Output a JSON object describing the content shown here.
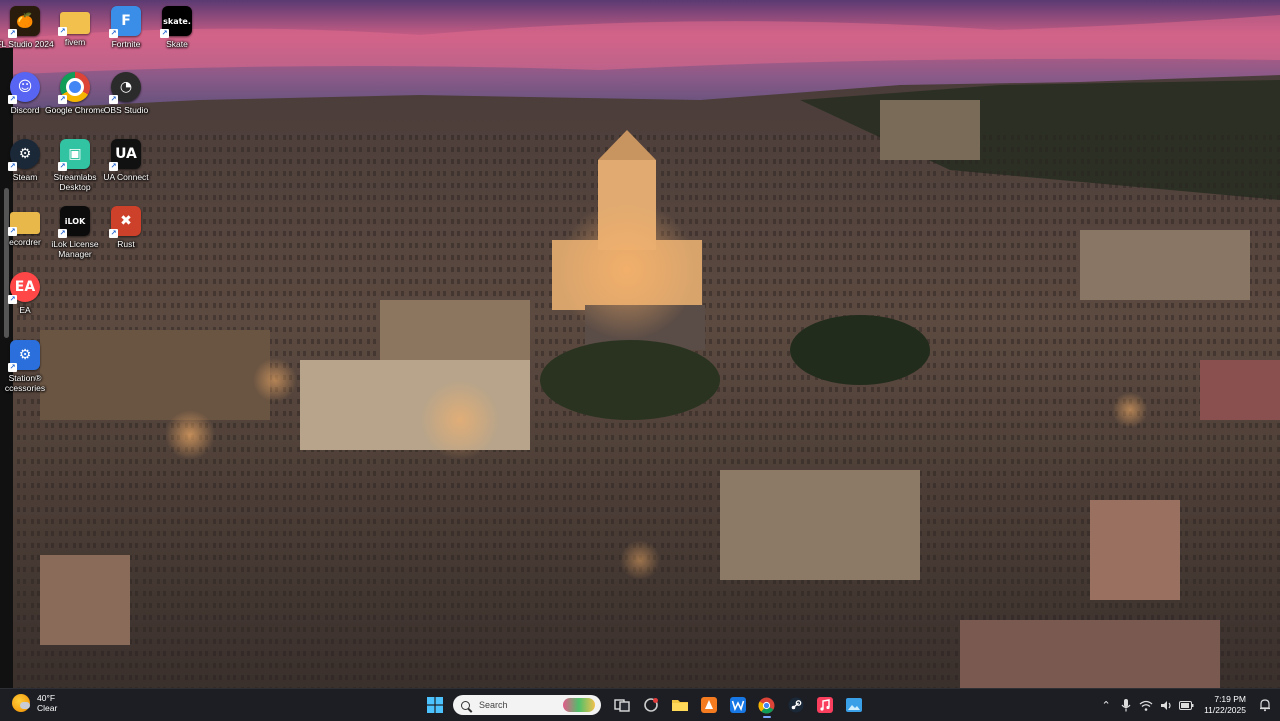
{
  "desktop": {
    "icons": [
      {
        "label": "FL Studio 2024",
        "icon": "fl-studio-icon",
        "bg": "#2a1c0c",
        "glyph": "🍊"
      },
      {
        "label": "fivem",
        "icon": "folder-icon",
        "bg": "#f2c14d",
        "glyph": ""
      },
      {
        "label": "Fortnite",
        "icon": "fortnite-icon",
        "bg": "#3a8ee8",
        "glyph": "F"
      },
      {
        "label": "Skate",
        "icon": "skate-icon",
        "bg": "#000000",
        "glyph": "skate."
      },
      {
        "label": "Discord",
        "icon": "discord-icon",
        "bg": "#5865f2",
        "glyph": "☺"
      },
      {
        "label": "Google Chrome",
        "icon": "chrome-icon",
        "bg": "#ffffff",
        "glyph": ""
      },
      {
        "label": "OBS Studio",
        "icon": "obs-icon",
        "bg": "#2b2b2b",
        "glyph": "◔"
      },
      {
        "label": "Steam",
        "icon": "steam-icon",
        "bg": "#1b2838",
        "glyph": "⚙"
      },
      {
        "label": "Streamlabs Desktop",
        "icon": "streamlabs-icon",
        "bg": "#31c3a2",
        "glyph": "▣"
      },
      {
        "label": "UA Connect",
        "icon": "ua-connect-icon",
        "bg": "#111111",
        "glyph": "UA"
      },
      {
        "label": "ecordrer",
        "icon": "folder-icon",
        "bg": "#e8b84a",
        "glyph": ""
      },
      {
        "label": "iLok License Manager",
        "icon": "ilok-icon",
        "bg": "#0b0b0b",
        "glyph": "iLOK"
      },
      {
        "label": "Rust",
        "icon": "rust-icon",
        "bg": "#cd412b",
        "glyph": "✖"
      },
      {
        "label": "EA",
        "icon": "ea-icon",
        "bg": "#ff4747",
        "glyph": "EA"
      },
      {
        "label": "Station® ccessories",
        "icon": "playstation-accessories-icon",
        "bg": "#2a6fdc",
        "glyph": "⚙"
      }
    ]
  },
  "taskbar": {
    "weather": {
      "temp": "40°F",
      "condition": "Clear",
      "icon": "weather-icon"
    },
    "search_placeholder": "Search",
    "pinned": [
      {
        "name": "start-button",
        "icon": "windows-logo-icon"
      },
      {
        "name": "search"
      },
      {
        "name": "task-view-button",
        "icon": "task-view-icon"
      },
      {
        "name": "copilot-button",
        "icon": "copilot-icon"
      },
      {
        "name": "file-explorer-button",
        "icon": "folder-icon"
      },
      {
        "name": "app-orange-button",
        "icon": "orange-app-icon"
      },
      {
        "name": "app-blue-w-button",
        "icon": "w-app-icon"
      },
      {
        "name": "chrome-taskbar-button",
        "icon": "chrome-icon"
      },
      {
        "name": "steam-taskbar-button",
        "icon": "steam-icon"
      },
      {
        "name": "music-taskbar-button",
        "icon": "music-icon"
      },
      {
        "name": "photos-taskbar-button",
        "icon": "photos-icon"
      }
    ],
    "clock": {
      "time": "7:19 PM",
      "date": "11/22/2025"
    }
  },
  "colors": {
    "taskbar_bg": "#1c1e24",
    "accent": "#7aa7ff"
  }
}
